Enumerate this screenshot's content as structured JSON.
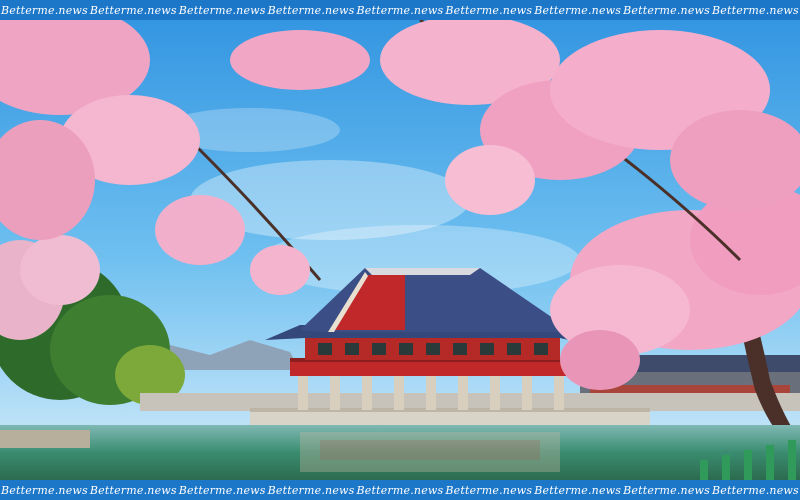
{
  "watermark": {
    "text": "Betterme.news",
    "repeat_count": 9
  },
  "scene": {
    "subject": "pagoda-pavilion",
    "colors": {
      "sky": "#4aa8e6",
      "blossom": "#f4a9c6",
      "roof": "#3b4f86",
      "pillar_red": "#c0282a",
      "water": "#2f7f6a",
      "band": "#1d77c9"
    }
  }
}
